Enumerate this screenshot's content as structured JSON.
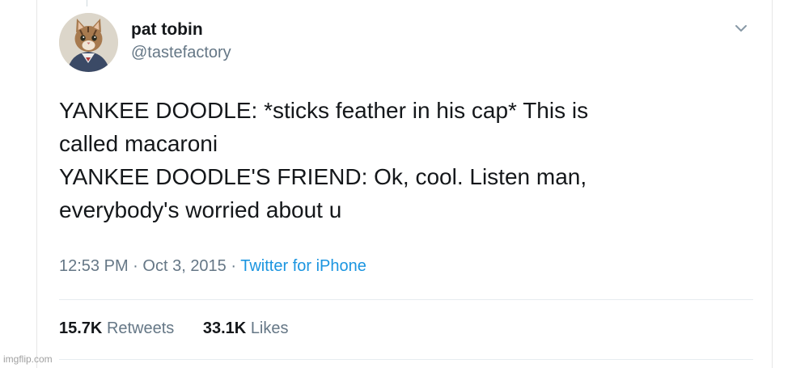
{
  "author": {
    "display_name": "pat tobin",
    "handle": "@tastefactory"
  },
  "tweet": {
    "lines": [
      "YANKEE DOODLE: *sticks feather in his cap* This is",
      "called macaroni",
      "YANKEE DOODLE'S FRIEND: Ok, cool. Listen man,",
      "everybody's worried about u"
    ],
    "time": "12:53 PM",
    "date": "Oct 3, 2015",
    "separator": "·",
    "source": "Twitter for iPhone"
  },
  "stats": {
    "retweets_count": "15.7K",
    "retweets_label": "Retweets",
    "likes_count": "33.1K",
    "likes_label": "Likes"
  },
  "icons": {
    "menu": "chevron-down-icon",
    "avatar": "cat-avatar"
  },
  "colors": {
    "text": "#14171a",
    "secondary": "#657786",
    "link": "#1b95e0",
    "divider": "#e6ecf0"
  },
  "watermark": "imgflip.com"
}
